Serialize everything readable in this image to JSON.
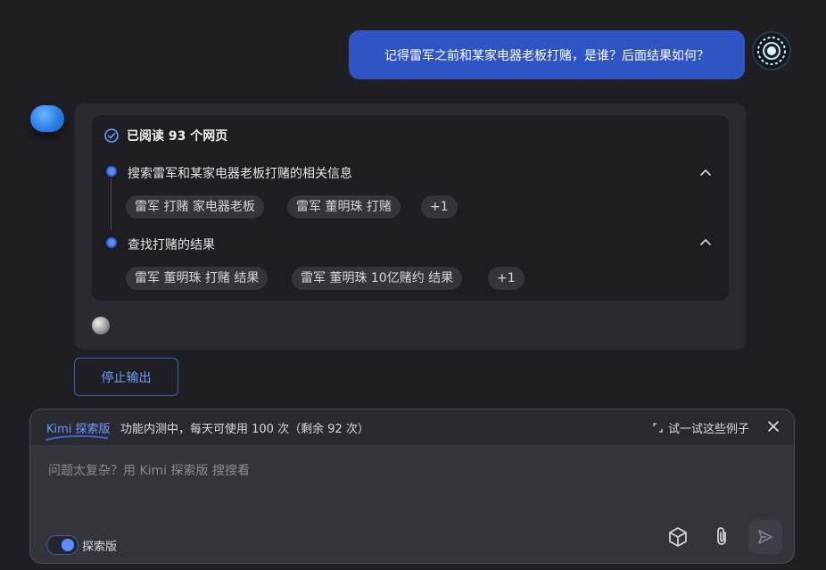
{
  "conversation": {
    "user_message": "记得雷军之前和某家电器老板打赌，是谁？后面结果如何？",
    "read_summary": "已阅读 93 个网页",
    "steps": [
      {
        "title": "搜索雷军和某家电器老板打赌的相关信息",
        "chips": [
          "雷军 打赌 家电器老板",
          "雷军 董明珠 打赌",
          "+1"
        ]
      },
      {
        "title": "查找打赌的结果",
        "chips": [
          "雷军 董明珠 打赌 结果",
          "雷军 董明珠 10亿赌约 结果",
          "+1"
        ]
      }
    ],
    "stop_label": "停止输出"
  },
  "composer": {
    "banner_tag": "Kimi 探索版",
    "banner_text": "功能内测中，每天可使用 100 次（剩余 92 次）",
    "try_examples": "试一试这些例子",
    "placeholder": "问题太复杂？用 Kimi 探索版 搜搜看",
    "toggle_label": "探索版",
    "toggle_on": true
  },
  "icons": {
    "check": "circle-check-icon",
    "collapse": "chevron-up-icon",
    "close": "close-icon",
    "expand": "expand-icon",
    "cube": "cube-icon",
    "attach": "paperclip-icon",
    "send": "send-icon"
  },
  "colors": {
    "accent": "#5b8cff",
    "user_bubble": "#2f55c4",
    "background": "#1f1f23"
  }
}
